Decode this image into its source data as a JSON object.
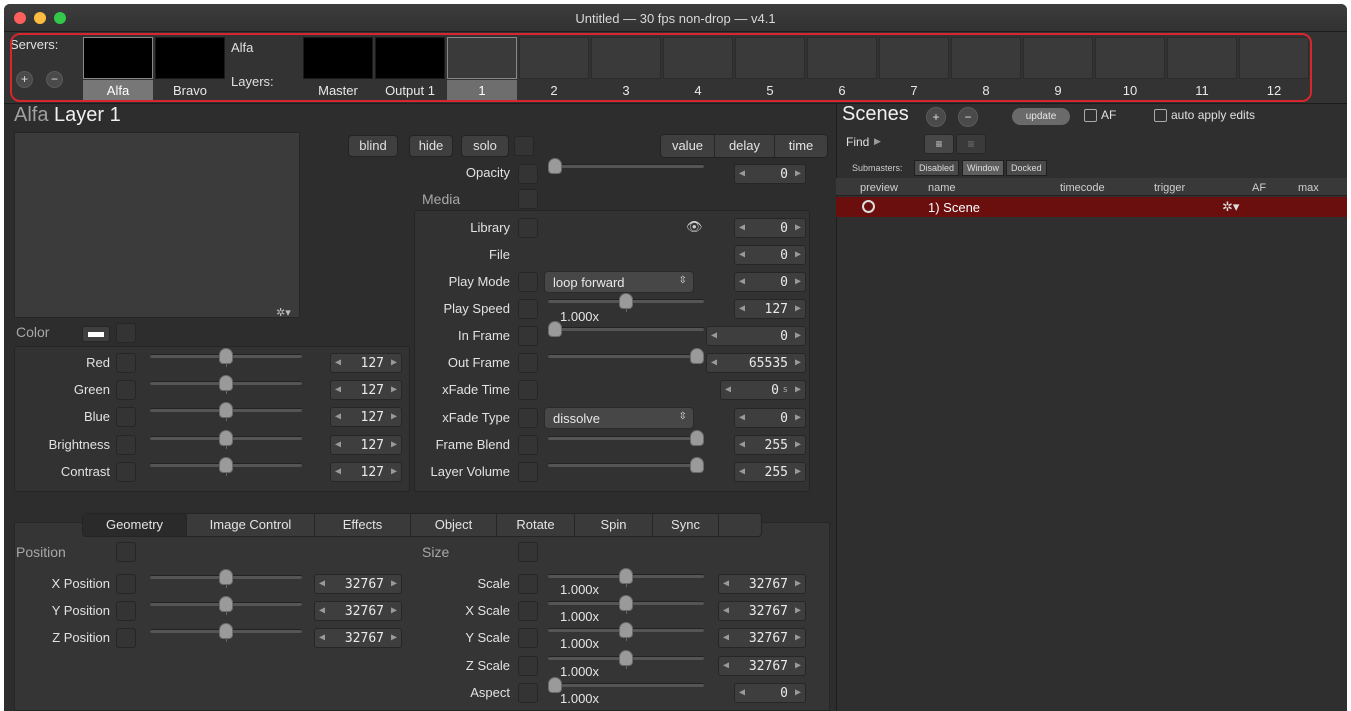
{
  "window": {
    "title": "Untitled  —  30 fps non-drop  —  v4.1"
  },
  "colors": {
    "accent_red": "#d7262e",
    "scene_row": "#6b0e0e",
    "background": "#2d2d2d"
  },
  "servers": {
    "label": "Servers:",
    "add_icon": "plus-circle-icon",
    "remove_icon": "minus-circle-icon",
    "items": [
      "Alfa",
      "Bravo"
    ],
    "selected": "Alfa"
  },
  "layers": {
    "server_name": "Alfa",
    "label": "Layers:",
    "special": [
      "Master",
      "Output 1"
    ],
    "numbers": [
      "1",
      "2",
      "3",
      "4",
      "5",
      "6",
      "7",
      "8",
      "9",
      "10",
      "11",
      "12"
    ],
    "selected": "1"
  },
  "layer_title": {
    "server": "Alfa",
    "name": "Layer 1"
  },
  "buttons": {
    "blind": "blind",
    "hide": "hide",
    "solo": "solo"
  },
  "mode_tabs": [
    "value",
    "delay",
    "time"
  ],
  "opacity": {
    "label": "Opacity",
    "value": "0",
    "level": 0
  },
  "media": {
    "header": "Media",
    "library": {
      "label": "Library",
      "value": "0"
    },
    "file": {
      "label": "File",
      "value": "0"
    },
    "play_mode": {
      "label": "Play Mode",
      "selected": "loop forward",
      "value": "0"
    },
    "play_speed": {
      "label": "Play Speed",
      "display": "1.000x",
      "value": "127",
      "level": 0.5
    },
    "in_frame": {
      "label": "In Frame",
      "value": "0",
      "level": 0
    },
    "out_frame": {
      "label": "Out Frame",
      "value": "65535",
      "level": 1
    },
    "xfade_time": {
      "label": "xFade Time",
      "value": "0",
      "unit": "s"
    },
    "xfade_type": {
      "label": "xFade Type",
      "selected": "dissolve",
      "value": "0"
    },
    "frame_blend": {
      "label": "Frame Blend",
      "value": "255",
      "level": 1
    },
    "layer_volume": {
      "label": "Layer Volume",
      "value": "255",
      "level": 1
    }
  },
  "color": {
    "header": "Color",
    "rows": [
      {
        "label": "Red",
        "value": "127",
        "level": 0.5
      },
      {
        "label": "Green",
        "value": "127",
        "level": 0.5
      },
      {
        "label": "Blue",
        "value": "127",
        "level": 0.5
      },
      {
        "label": "Brightness",
        "value": "127",
        "level": 0.5
      },
      {
        "label": "Contrast",
        "value": "127",
        "level": 0.5
      }
    ]
  },
  "tabs": [
    "Geometry",
    "Image Control",
    "Effects",
    "Object",
    "Rotate",
    "Spin",
    "Sync"
  ],
  "active_tab": "Geometry",
  "position": {
    "header": "Position",
    "rows": [
      {
        "label": "X Position",
        "value": "32767",
        "level": 0.5
      },
      {
        "label": "Y Position",
        "value": "32767",
        "level": 0.5
      },
      {
        "label": "Z Position",
        "value": "32767",
        "level": 0.5
      }
    ]
  },
  "size": {
    "header": "Size",
    "rows": [
      {
        "label": "Scale",
        "display": "1.000x",
        "value": "32767",
        "level": 0.5
      },
      {
        "label": "X Scale",
        "display": "1.000x",
        "value": "32767",
        "level": 0.5
      },
      {
        "label": "Y Scale",
        "display": "1.000x",
        "value": "32767",
        "level": 0.5
      },
      {
        "label": "Z Scale",
        "display": "1.000x",
        "value": "32767",
        "level": 0.5
      },
      {
        "label": "Aspect",
        "display": "1.000x",
        "value": "0",
        "level": 0
      }
    ]
  },
  "scenes": {
    "title": "Scenes",
    "update": "update",
    "af_label": "AF",
    "auto_apply": "auto apply edits",
    "find": "Find",
    "submasters_label": "Submasters:",
    "submaster_options": [
      "Disabled",
      "Window",
      "Docked"
    ],
    "columns": [
      "preview",
      "name",
      "timecode",
      "trigger",
      "AF",
      "max"
    ],
    "rows": [
      {
        "name": "1) Scene"
      }
    ]
  }
}
